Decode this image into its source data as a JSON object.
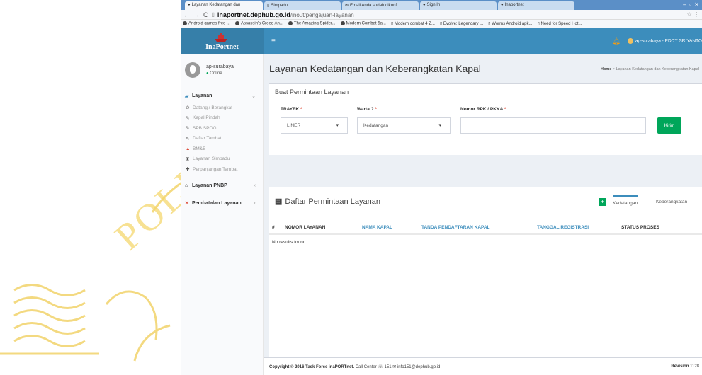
{
  "browser": {
    "tabs": [
      {
        "label": "Layanan Kedatangan dan",
        "active": true
      },
      {
        "label": "Simpadu",
        "active": false
      },
      {
        "label": "Email Anda sudah dikonf",
        "active": false
      },
      {
        "label": "Sign In",
        "active": false
      },
      {
        "label": "Inaportnet",
        "active": false
      }
    ],
    "url_domain": "inaportnet.dephub.go.id",
    "url_path": "/inout/pengajuan-layanan",
    "bookmarks": [
      "Android games free ...",
      "Assassin's Creed An...",
      "The Amazing Spider...",
      "Modern Combat 5a...",
      "Modern combat 4 Z...",
      "Evolve: Legendary ...",
      "Worms Android apk...",
      "Need for Speed Hot..."
    ]
  },
  "header": {
    "logo_text": "InaPortnet",
    "user_label": "ap-surabaya - EDDY SRIYANTO"
  },
  "sidebar": {
    "username": "ap-surabaya",
    "status": "Online",
    "section_layanan": "Layanan",
    "layanan_items": [
      "Datang / Berangkat",
      "Kapal Pindah",
      "SPB SPOG",
      "Daftar Tambat",
      "BM&B",
      "Layanan Simpadu",
      "Perpanjangan Tambat"
    ],
    "section_pnbp": "Layanan PNBP",
    "section_batal": "Pembatalan Layanan"
  },
  "main": {
    "page_title": "Layanan Kedatangan dan Keberangkatan Kapal",
    "breadcrumb_home": "Home",
    "breadcrumb_current": "Layanan Kedatangan dan Keberangkatan Kapal",
    "form": {
      "title": "Buat Permintaan Layanan",
      "trayek_label": "TRAYEK",
      "trayek_value": "LINER",
      "warta_label": "Warta ?",
      "warta_value": "Kedatangan",
      "rpk_label": "Nomor RPK / PKKA",
      "rpk_value": "",
      "required_mark": "*",
      "submit_label": "Kirim"
    },
    "list": {
      "title": "Daftar Permintaan Layanan",
      "tab_1": "Kedatangan",
      "tab_2": "Keberangkatan",
      "columns": [
        "#",
        "NOMOR LAYANAN",
        "NAMA KAPAL",
        "TANDA PENDAFTARAN KAPAL",
        "TANGGAL REGISTRASI",
        "STATUS PROSES"
      ],
      "empty_text": "No results found."
    },
    "footer": {
      "copyright": "Copyright © 2016 Task Force inaPORTnet.",
      "contact": "Call Center ☏ 151 ✉ info151@dephub.go.id",
      "revision_label": "Revision",
      "revision_value": "1128"
    }
  },
  "watermark": {
    "text": "POLITE"
  },
  "colors": {
    "header_blue": "#3c8dbc",
    "logo_blue": "#367fa9",
    "success_green": "#00a65a",
    "watermark_yellow": "#f5d76e"
  }
}
